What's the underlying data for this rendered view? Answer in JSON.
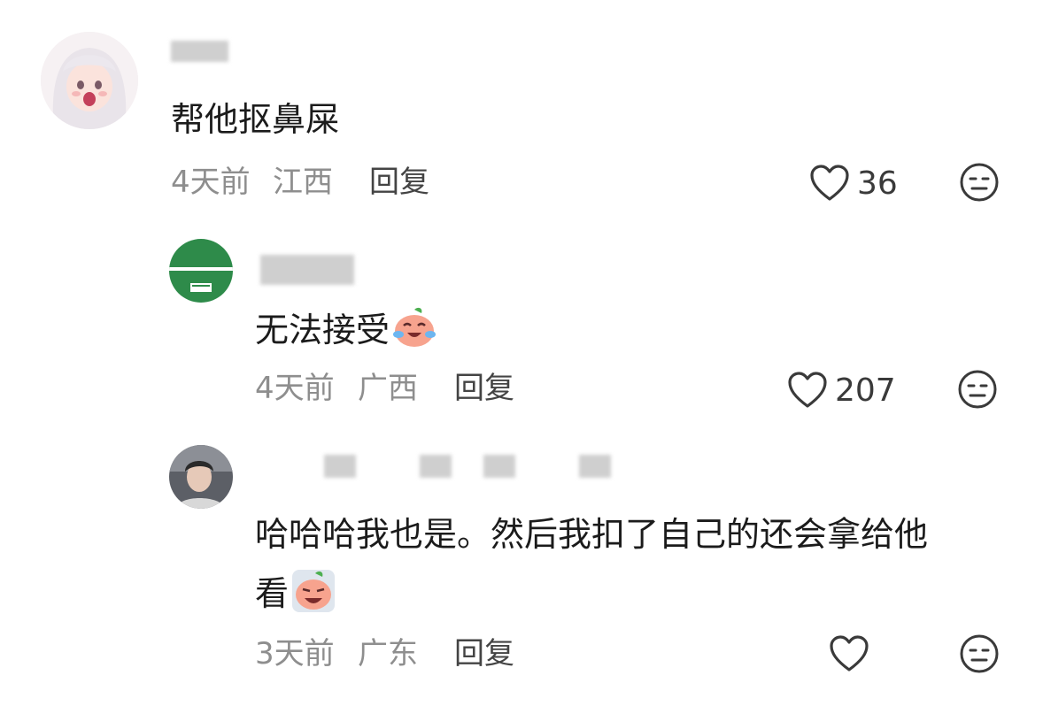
{
  "comments": [
    {
      "text": "帮他抠鼻屎",
      "time": "4天前",
      "location": "江西",
      "reply_label": "回复",
      "likes": "36"
    },
    {
      "text": "无法接受",
      "time": "4天前",
      "location": "广西",
      "reply_label": "回复",
      "likes": "207"
    },
    {
      "text_line1": "哈哈哈我也是。然后我扣了自己的还会拿给他",
      "text_line2": "看",
      "time": "3天前",
      "location": "广东",
      "reply_label": "回复",
      "likes": ""
    }
  ],
  "icons": {
    "like": "heart-outline-icon",
    "dislike": "meh-face-icon",
    "emoji1": "crying-laughing-peach-emoji",
    "emoji2": "crying-peach-emoji"
  },
  "colors": {
    "text": "#1b1b1b",
    "meta": "#8e8e8e",
    "icon": "#3a3a3a"
  }
}
